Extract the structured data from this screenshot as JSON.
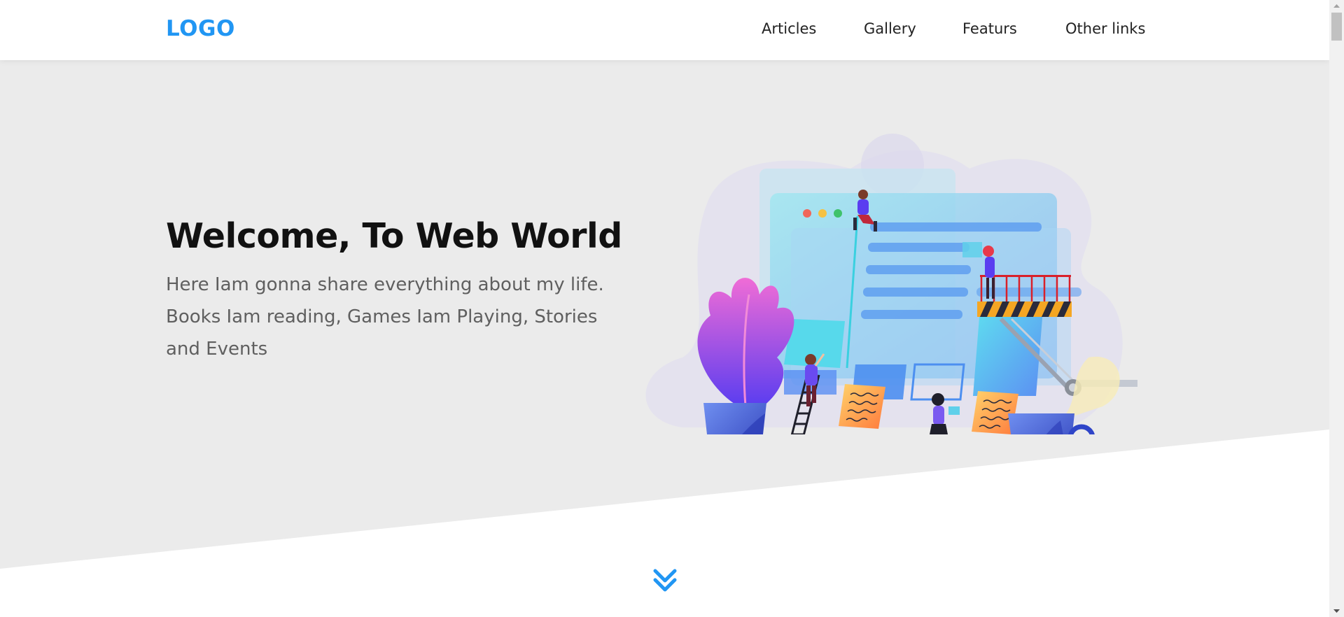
{
  "header": {
    "logo": "LOGO",
    "nav": [
      {
        "label": "Articles"
      },
      {
        "label": "Gallery"
      },
      {
        "label": "Featurs"
      },
      {
        "label": "Other links"
      }
    ]
  },
  "hero": {
    "title": "Welcome, To Web World",
    "text": "Here Iam gonna share everything about my life. Books Iam reading, Games Iam Playing, Stories and Events",
    "illustration": "website-construction-illustration",
    "scroll_icon": "chevron-double-down-icon"
  },
  "colors": {
    "accent": "#2196f3",
    "hero_background": "#ebebeb",
    "title": "#111111",
    "body_text": "#5f5f5f",
    "nav_text": "#222222"
  }
}
